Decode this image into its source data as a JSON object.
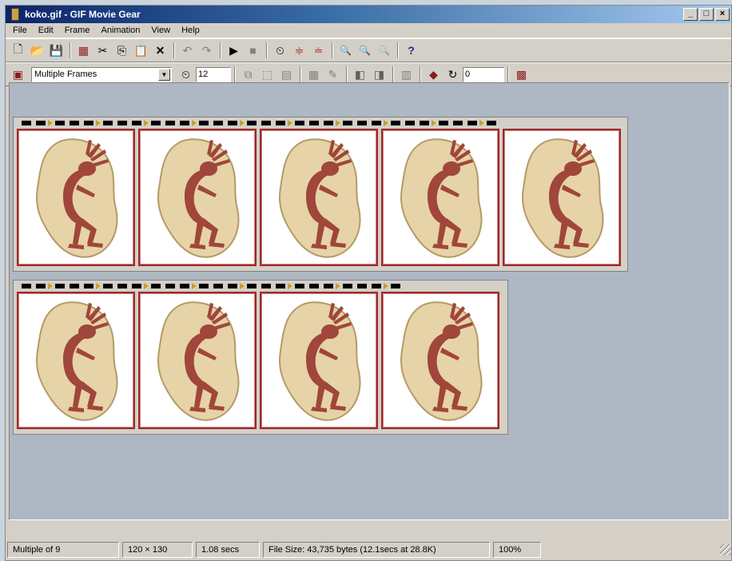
{
  "window": {
    "title": "koko.gif - GIF Movie Gear",
    "controls": {
      "minimize": "_",
      "maximize": "□",
      "close": "×"
    }
  },
  "menu": [
    "File",
    "Edit",
    "Frame",
    "Animation",
    "View",
    "Help"
  ],
  "toolbar1": {
    "icons": [
      "new-icon",
      "open-icon",
      "save-icon",
      "insert-frames-icon",
      "cut-icon",
      "copy-icon",
      "paste-icon",
      "delete-icon",
      "undo-icon",
      "redo-icon",
      "play-icon",
      "stop-icon",
      "timing-icon",
      "align-up-icon",
      "align-down-icon",
      "zoom-in-icon",
      "zoom-out-icon",
      "zoom-reset-icon",
      "help-icon"
    ],
    "glyphs": [
      "🗋",
      "📂",
      "💾",
      "▦",
      "✂",
      "⎘",
      "📋",
      "✕",
      "↶",
      "↷",
      "▶",
      "■",
      "⏲",
      "≑",
      "≐",
      "🔍",
      "🔍",
      "🔍",
      "?"
    ]
  },
  "toolbar2": {
    "view_mode": "Multiple Frames",
    "delay_value": "12",
    "loop_value": "0"
  },
  "frames": {
    "count": 9,
    "row1": 5,
    "row2": 4
  },
  "status": {
    "selection": "Multiple of 9",
    "dimensions": "120 × 130",
    "delay": "1.08 secs",
    "file_size": "File Size: 43,735 bytes (12.1secs at 28.8K)",
    "zoom": "100%"
  },
  "colors": {
    "title_bar": "#0a246a",
    "frame_border": "#9b2b2b",
    "stone": "#e6d3a8",
    "figure": "#a0463a"
  }
}
